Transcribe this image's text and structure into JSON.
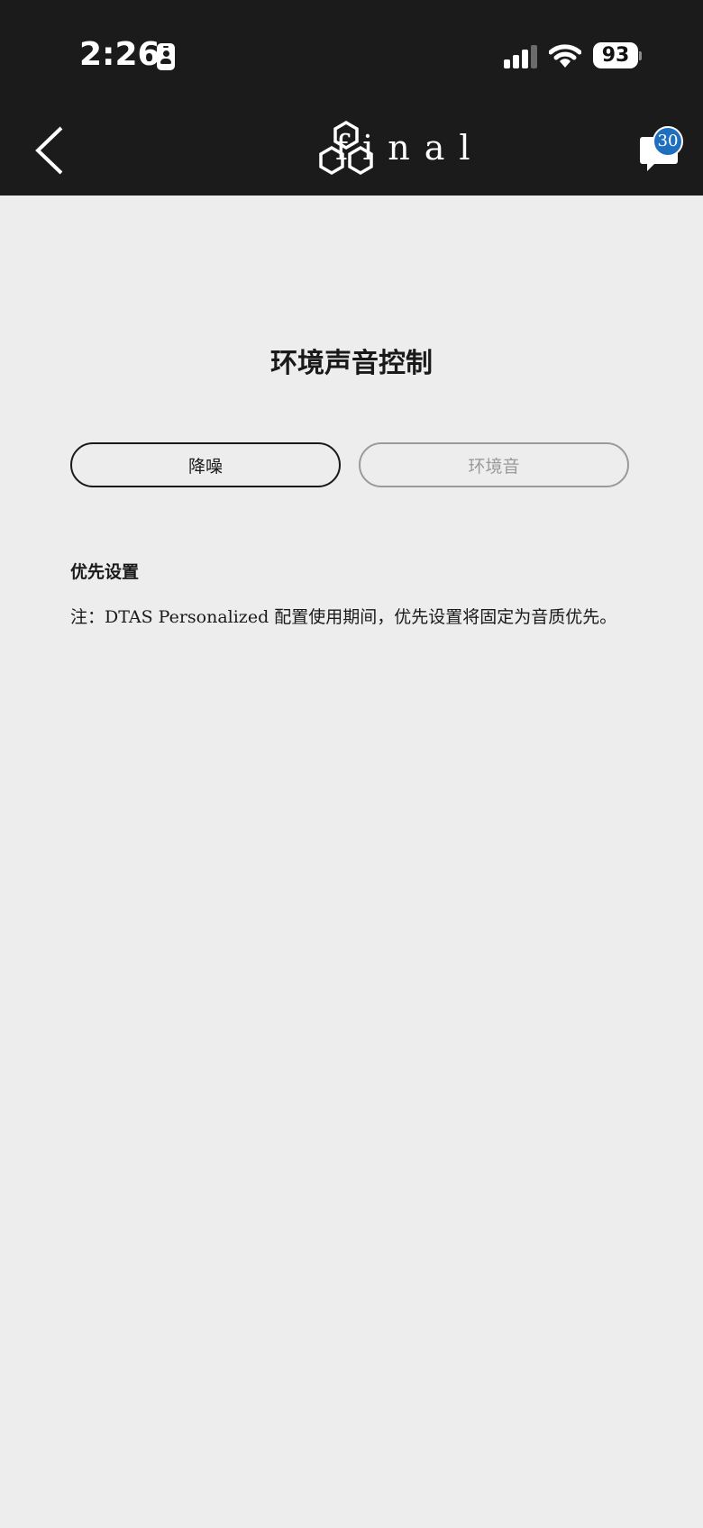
{
  "status_bar": {
    "time": "2:26",
    "battery": "93",
    "icons": [
      "id-badge-icon",
      "cellular-signal-icon",
      "wifi-icon",
      "battery-icon"
    ]
  },
  "header": {
    "back_icon": "chevron-left-icon",
    "logo_text": "final",
    "message_icon": "chat-bubble-icon",
    "message_count": "30",
    "colors": {
      "background": "#1b1b1b",
      "badge": "#1f6fbf"
    }
  },
  "main": {
    "title": "环境声音控制",
    "tabs": [
      {
        "label": "降噪",
        "selected": true
      },
      {
        "label": "环境音",
        "selected": false
      }
    ],
    "section_label": "优先设置",
    "note": "注：DTAS Personalized 配置使用期间，优先设置将固定为音质优先。",
    "colors": {
      "background": "#ededed",
      "text": "#1a1a1a",
      "inactive": "#9a9a9a"
    }
  }
}
